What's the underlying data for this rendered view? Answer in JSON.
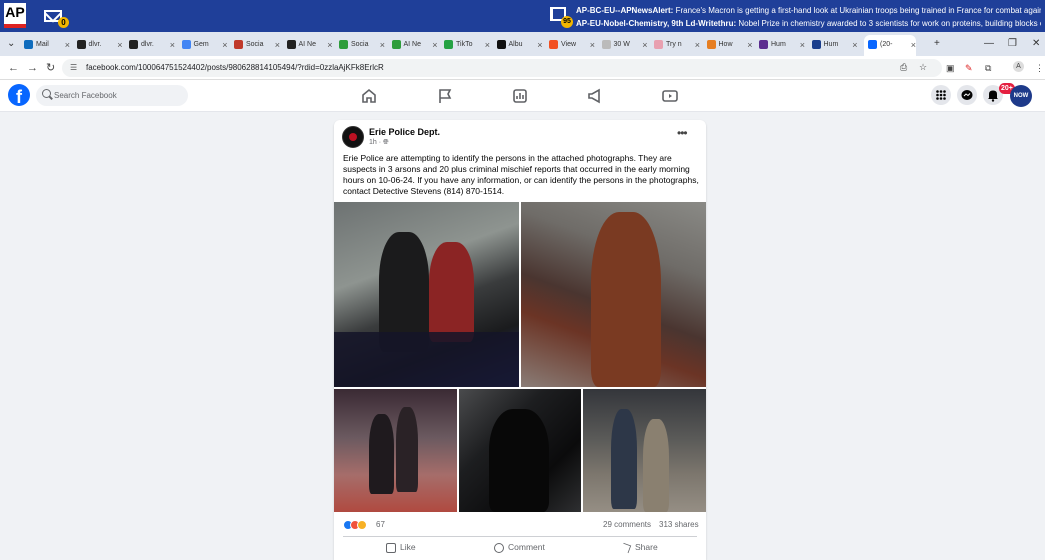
{
  "ap_bar": {
    "logo": "AP",
    "mail_count": "0",
    "alert_count": "95",
    "alerts": [
      {
        "slug": "AP-BC-EU--APNewsAlert:",
        "text": " France's Macron is getting a first-hand look at Ukrainian troops being trained in France for combat against Russia"
      },
      {
        "slug": "AP-EU-Nobel-Chemistry, 9th Ld-Writethru:",
        "text": " Nobel Prize in chemistry awarded to 3 scientists for work on proteins, building blocks of life By DANIEL..."
      }
    ]
  },
  "tabs": [
    {
      "label": "Mail",
      "color": "#0f6cbd"
    },
    {
      "label": "dlvr.",
      "color": "#222222"
    },
    {
      "label": "dlvr.",
      "color": "#222222"
    },
    {
      "label": "Gem",
      "color": "#4285f4"
    },
    {
      "label": "Socia",
      "color": "#c0392b"
    },
    {
      "label": "AI Ne",
      "color": "#222222"
    },
    {
      "label": "Socia",
      "color": "#2e9d3b"
    },
    {
      "label": "AI Ne",
      "color": "#2e9d3b"
    },
    {
      "label": "TikTo",
      "color": "#25a244"
    },
    {
      "label": "Albu",
      "color": "#111111"
    },
    {
      "label": "View",
      "color": "#f25022"
    },
    {
      "label": "30 W",
      "color": "#bbbbbb"
    },
    {
      "label": "Try n",
      "color": "#e8a0b0"
    },
    {
      "label": "How",
      "color": "#e67e22"
    },
    {
      "label": "Hum",
      "color": "#5b2c8f"
    },
    {
      "label": "Hum",
      "color": "#1a3e8c"
    },
    {
      "label": "(20-",
      "color": "#0866ff",
      "active": true
    }
  ],
  "address_bar": {
    "url": "facebook.com/100064751524402/posts/980628814105494/?rdid=0zzlaAjKFk8ErlcR"
  },
  "fb_header": {
    "search_placeholder": "Search Facebook",
    "notification_badge": "20+",
    "profile_label": "NOW"
  },
  "post": {
    "page_name": "Erie Police Dept.",
    "time": "1h",
    "text": "Erie Police are attempting to identify the persons in the attached photographs. They are suspects in 3 arsons and 20 plus criminal mischief reports that occurred in the early morning hours on 10-06-24. If you have any information, or can identify the persons in the photographs, contact Detective Stevens (814) 870-1514.",
    "reaction_count": "67",
    "comments": "29 comments",
    "shares": "313 shares",
    "actions": {
      "like": "Like",
      "comment": "Comment",
      "share": "Share"
    }
  },
  "colors": {
    "ap_blue": "#1f3f99",
    "fb_blue": "#0866ff",
    "badge_red": "#e41e3f"
  }
}
